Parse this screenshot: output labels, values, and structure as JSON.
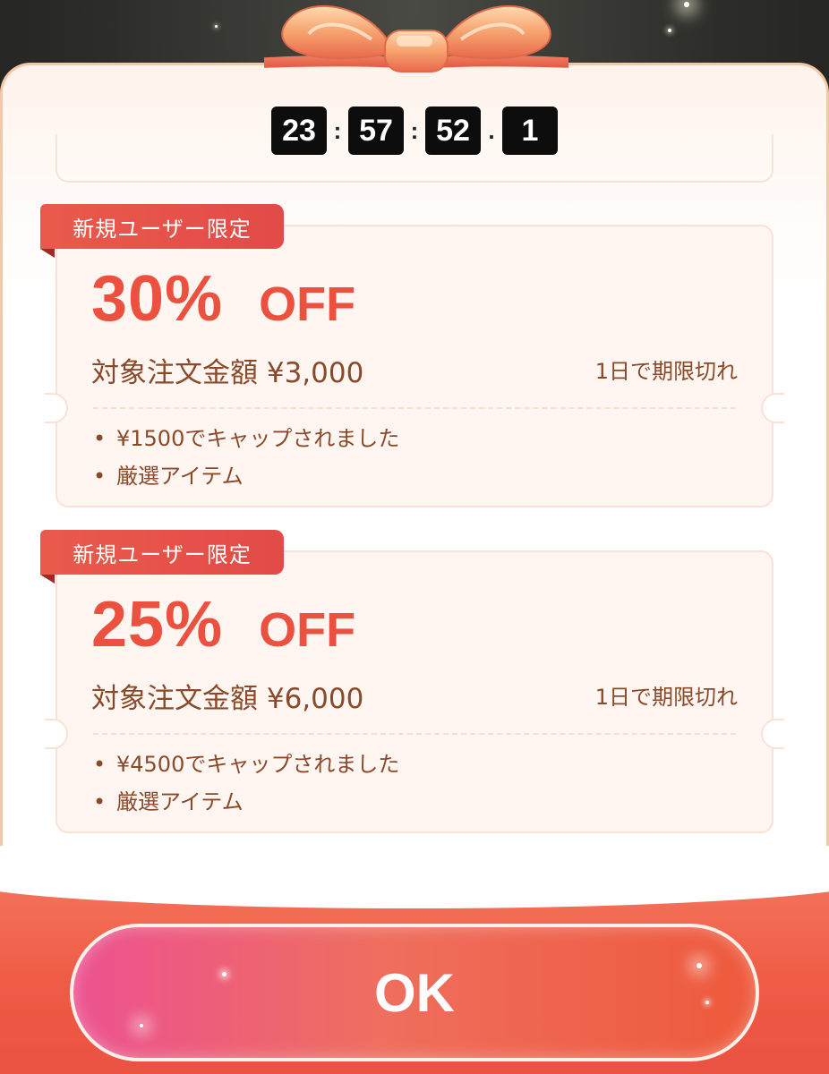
{
  "timer": {
    "hours": "23",
    "minutes": "57",
    "seconds": "52",
    "tenths": "1",
    "sep_hm": ":",
    "sep_ms": ":",
    "sep_s": "."
  },
  "coupons": [
    {
      "tag": "新規ユーザー限定",
      "percent": "30%",
      "off": "OFF",
      "condition": "対象注文金額 ¥3,000",
      "expiry": "1日で期限切れ",
      "bullets": [
        "¥1500でキャップされました",
        "厳選アイテム"
      ]
    },
    {
      "tag": "新規ユーザー限定",
      "percent": "25%",
      "off": "OFF",
      "condition": "対象注文金額 ¥6,000",
      "expiry": "1日で期限切れ",
      "bullets": [
        "¥4500でキャップされました",
        "厳選アイテム"
      ]
    }
  ],
  "ok_button": {
    "label": "OK"
  },
  "colors": {
    "accent_red": "#ec5140",
    "tag_red": "#e24b48",
    "text_brown": "#8a4a2a",
    "button_pink": "#ec5290",
    "button_orange": "#ee5a3c"
  },
  "icons": [
    "gift-bow-icon",
    "sparkle-icon"
  ]
}
